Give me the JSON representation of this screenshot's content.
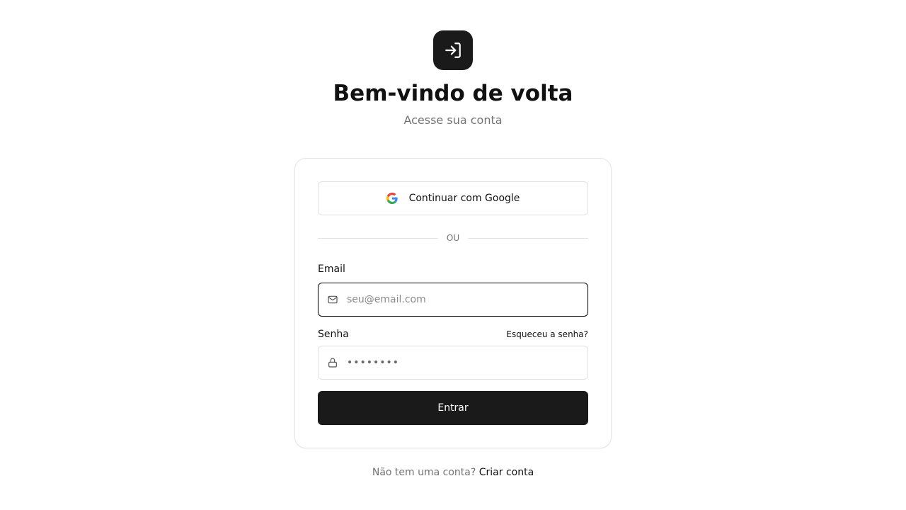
{
  "header": {
    "logo_icon": "log-in-icon",
    "title": "Bem-vindo de volta",
    "subtitle": "Acesse sua conta"
  },
  "login_card": {
    "google_button": {
      "icon": "google-icon",
      "label": "Continuar com Google"
    },
    "divider_text": "OU",
    "email": {
      "label": "Email",
      "icon": "mail-icon",
      "placeholder": "seu@email.com",
      "value": ""
    },
    "password": {
      "label": "Senha",
      "icon": "lock-icon",
      "forgot_label": "Esqueceu a senha?",
      "masked_value": "••••••••"
    },
    "submit_label": "Entrar"
  },
  "footer": {
    "prompt": "Não tem uma conta?",
    "link_label": "Criar conta"
  },
  "colors": {
    "primary": "#1a1a1a",
    "muted_text": "#737373",
    "border": "#e2e2e2"
  }
}
